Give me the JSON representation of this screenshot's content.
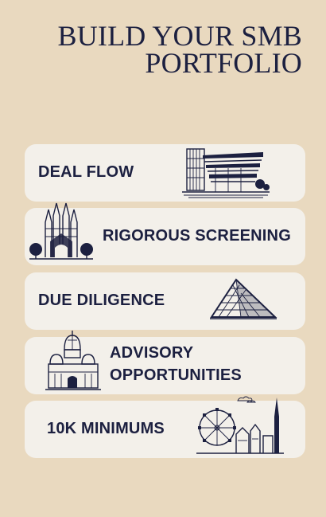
{
  "title": {
    "line1": "BUILD YOUR SMB",
    "line2": "PORTFOLIO"
  },
  "cards": [
    {
      "label": "DEAL FLOW",
      "icon": "guggenheim-museum-icon"
    },
    {
      "label": "RIGOROUS SCREENING",
      "icon": "sagrada-familia-icon"
    },
    {
      "label": "DUE DILIGENCE",
      "icon": "louvre-pyramid-icon"
    },
    {
      "label_line1": "ADVISORY",
      "label_line2": "OPPORTUNITIES",
      "icon": "sacre-coeur-icon"
    },
    {
      "label": "10K MINIMUMS",
      "icon": "vienna-skyline-icon"
    }
  ],
  "colors": {
    "background": "#e9d9bf",
    "card": "#f3f0ea",
    "ink": "#1c2040"
  }
}
